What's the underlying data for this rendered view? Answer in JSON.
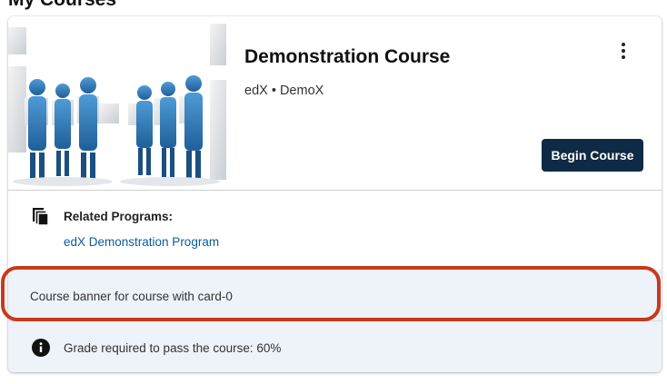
{
  "page": {
    "heading": "My Courses"
  },
  "course_card": {
    "title": "Demonstration Course",
    "provider": "edX",
    "separator": "•",
    "course_number": "DemoX",
    "begin_button_label": "Begin Course",
    "menu_icon": "kebab-menu-icon",
    "image_description_icon": "course-image"
  },
  "related_programs": {
    "label": "Related Programs:",
    "programs": [
      "edX Demonstration Program"
    ],
    "icon": "programs-icon"
  },
  "banner": {
    "text": "Course banner for course with card-0"
  },
  "grade": {
    "text": "Grade required to pass the course: 60%",
    "icon": "info-icon"
  },
  "colors": {
    "button": "#0f2a45",
    "link": "#0a5b9c",
    "banner_bg": "#eef2f9",
    "highlight": "#c73a1d"
  }
}
